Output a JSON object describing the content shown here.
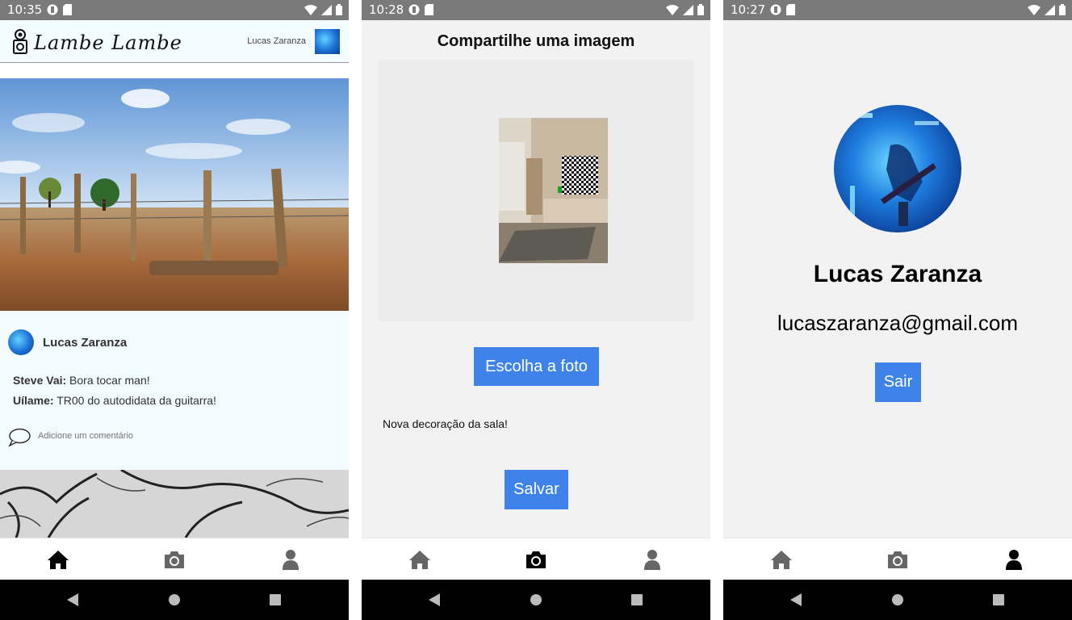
{
  "screens": [
    {
      "status_time": "10:35",
      "header": {
        "logo_text": "Lambe Lambe",
        "user_name": "Lucas Zaranza"
      },
      "post": {
        "author": "Lucas Zaranza",
        "comments": [
          {
            "user": "Steve Vai:",
            "text": "Bora tocar man!"
          },
          {
            "user": "Uílame:",
            "text": "TR00 do autodidata da guitarra!"
          }
        ],
        "comment_placeholder": "Adicione um comentário"
      },
      "active_tab": "home"
    },
    {
      "status_time": "10:28",
      "title": "Compartilhe uma imagem",
      "choose_button": "Escolha a foto",
      "caption": "Nova decoração da sala!",
      "save_button": "Salvar",
      "active_tab": "camera"
    },
    {
      "status_time": "10:27",
      "name": "Lucas Zaranza",
      "email": "lucaszaranza@gmail.com",
      "logout_button": "Sair",
      "active_tab": "profile"
    }
  ],
  "colors": {
    "accent_button": "#3f83ea",
    "status_bar": "#7a7a7a",
    "feed_background": "#f2fbff",
    "screen_background": "#f2f2f2",
    "tab_active": "#000000",
    "tab_inactive": "#666666"
  },
  "icons": {
    "tabs": [
      "home-icon",
      "camera-icon",
      "user-icon"
    ],
    "status": [
      "notification-icon",
      "sd-card-icon",
      "wifi-icon",
      "signal-icon",
      "battery-icon"
    ],
    "system_nav": [
      "back-icon",
      "home-circle-icon",
      "recent-apps-icon"
    ]
  }
}
